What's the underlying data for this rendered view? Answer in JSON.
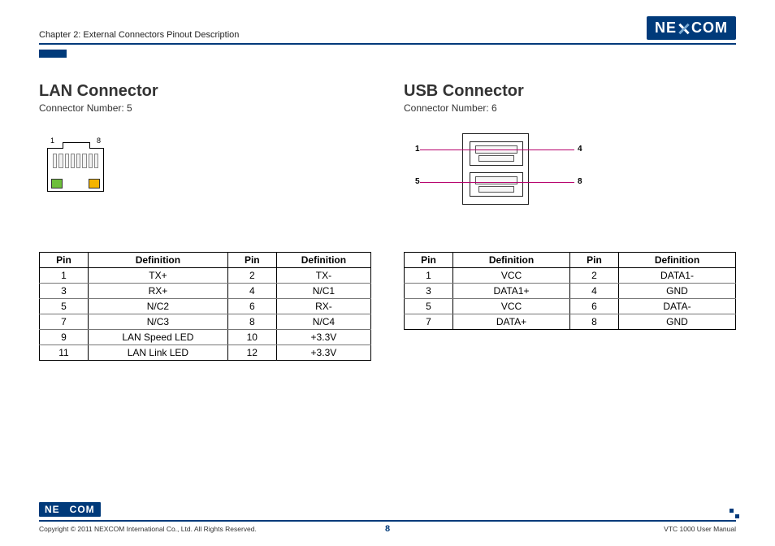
{
  "header": {
    "chapter": "Chapter 2: External Connectors Pinout Description",
    "brand_pre": "NE",
    "brand_post": "COM"
  },
  "lan": {
    "title": "LAN Connector",
    "subtitle": "Connector Number: 5",
    "pin_label_left": "1",
    "pin_label_right": "8",
    "table": {
      "head": [
        "Pin",
        "Definition",
        "Pin",
        "Definition"
      ],
      "rows": [
        [
          "1",
          "TX+",
          "2",
          "TX-"
        ],
        [
          "3",
          "RX+",
          "4",
          "N/C1"
        ],
        [
          "5",
          "N/C2",
          "6",
          "RX-"
        ],
        [
          "7",
          "N/C3",
          "8",
          "N/C4"
        ],
        [
          "9",
          "LAN Speed LED",
          "10",
          "+3.3V"
        ],
        [
          "11",
          "LAN Link LED",
          "12",
          "+3.3V"
        ]
      ]
    }
  },
  "usb": {
    "title": "USB Connector",
    "subtitle": "Connector Number: 6",
    "labels": {
      "tl": "1",
      "tr": "4",
      "bl": "5",
      "br": "8"
    },
    "table": {
      "head": [
        "Pin",
        "Definition",
        "Pin",
        "Definition"
      ],
      "rows": [
        [
          "1",
          "VCC",
          "2",
          "DATA1-"
        ],
        [
          "3",
          "DATA1+",
          "4",
          "GND"
        ],
        [
          "5",
          "VCC",
          "6",
          "DATA-"
        ],
        [
          "7",
          "DATA+",
          "8",
          "GND"
        ]
      ]
    }
  },
  "footer": {
    "copyright": "Copyright © 2011 NEXCOM International Co., Ltd. All Rights Reserved.",
    "page": "8",
    "manual": "VTC 1000 User Manual",
    "brand_pre": "NE",
    "brand_post": "COM"
  }
}
